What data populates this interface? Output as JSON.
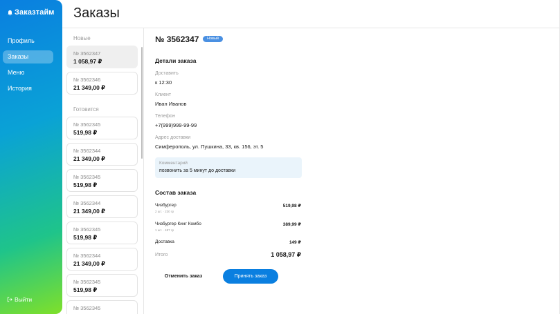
{
  "app": {
    "logo_text": "Заказтайм"
  },
  "sidebar": {
    "items": [
      {
        "label": "Профиль"
      },
      {
        "label": "Заказы"
      },
      {
        "label": "Меню"
      },
      {
        "label": "История"
      }
    ],
    "logout_label": "Выйти"
  },
  "header": {
    "title": "Заказы"
  },
  "orders": {
    "new_title": "Новые",
    "cooking_title": "Готовится",
    "new": [
      {
        "num": "№ 3562347",
        "price": "1 058,97 ₽"
      },
      {
        "num": "№ 3562346",
        "price": "21 349,00 ₽"
      }
    ],
    "cooking": [
      {
        "num": "№ 3562345",
        "price": "519,98 ₽"
      },
      {
        "num": "№ 3562344",
        "price": "21 349,00 ₽"
      },
      {
        "num": "№ 3562345",
        "price": "519,98 ₽"
      },
      {
        "num": "№ 3562344",
        "price": "21 349,00 ₽"
      },
      {
        "num": "№ 3562345",
        "price": "519,98 ₽"
      },
      {
        "num": "№ 3562344",
        "price": "21 349,00 ₽"
      },
      {
        "num": "№ 3562345",
        "price": "519,98 ₽"
      },
      {
        "num": "№ 3562345",
        "price": ""
      }
    ]
  },
  "detail": {
    "title": "№ 3562347",
    "badge": "Новый",
    "details_title": "Детали заказа",
    "delivery_label": "Доставить",
    "delivery_value": "к 12:30",
    "client_label": "Клиент",
    "client_value": "Иван Иванов",
    "phone_label": "Телефон",
    "phone_value": "+7(999)999-99-99",
    "address_label": "Адрес доставки",
    "address_value": "Симферополь, ул. Пушкина, 33, кв. 156, эт. 5",
    "comment_label": "Комментарий",
    "comment_value": "позвонить за 5 минут до доставки",
    "composition_title": "Состав заказа",
    "items": [
      {
        "name": "Чизбургер",
        "sub": "2 шт. · 230 гр",
        "price": "519,98 ₽"
      },
      {
        "name": "Чизбургер Кинг Комбо",
        "sub": "1 шт. · 487 гр",
        "price": "389,99 ₽"
      }
    ],
    "delivery_cost_label": "Доставка",
    "delivery_cost_value": "149 ₽",
    "total_label": "Итого",
    "total_value": "1 058,97 ₽",
    "cancel_label": "Отменить заказ",
    "accept_label": "Принять заказ"
  },
  "colors": {
    "accent": "#0a7fe0",
    "badge": "#4a90e2",
    "comment_bg": "#eaf4fb"
  }
}
